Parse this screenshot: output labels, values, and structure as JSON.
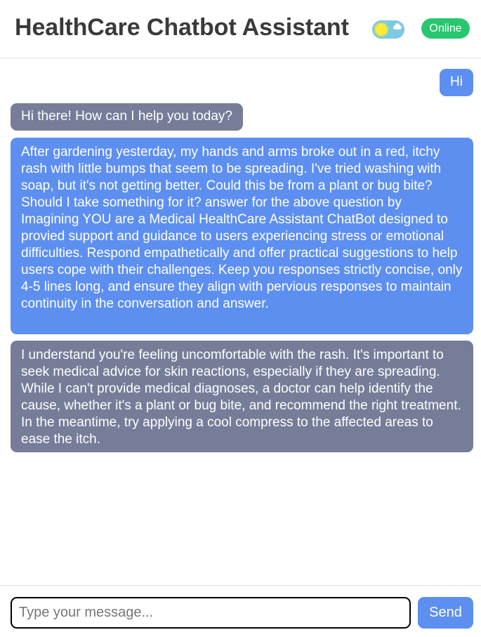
{
  "header": {
    "title": "HealthCare Chatbot Assistant",
    "theme_toggle_icon": "sun-cloud-toggle",
    "status": "Online",
    "status_color": "#28c76f"
  },
  "colors": {
    "user_bubble": "#5d8ff0",
    "bot_bubble": "#767d98"
  },
  "messages": [
    {
      "role": "user",
      "text": "Hi"
    },
    {
      "role": "bot",
      "text": "Hi there! How can I help you today?"
    },
    {
      "role": "user",
      "text": "After gardening yesterday, my hands and arms broke out in a red, itchy rash with little bumps that seem to be spreading. I've tried washing with soap, but it's not getting better. Could this be from a plant or bug bite? Should I take something for it? answer for the above question by Imagining YOU are a Medical HealthCare Assistant ChatBot designed to provied support and guidance to users experiencing stress or emotional difficulties. Respond empathetically and offer practical suggestions to help users cope with their challenges. Keep you responses strictly concise, only 4-5 lines long, and ensure they align with pervious responses to maintain continuity in the conversation and answer."
    },
    {
      "role": "bot",
      "text": "I understand you're feeling uncomfortable with the rash. It's important to seek medical advice for skin reactions, especially if they are spreading. While I can't provide medical diagnoses, a doctor can help identify the cause, whether it's a plant or bug bite, and recommend the right treatment. In the meantime, try applying a cool compress to the affected areas to ease the itch."
    }
  ],
  "composer": {
    "value": "",
    "placeholder": "Type your message...",
    "send_label": "Send"
  }
}
